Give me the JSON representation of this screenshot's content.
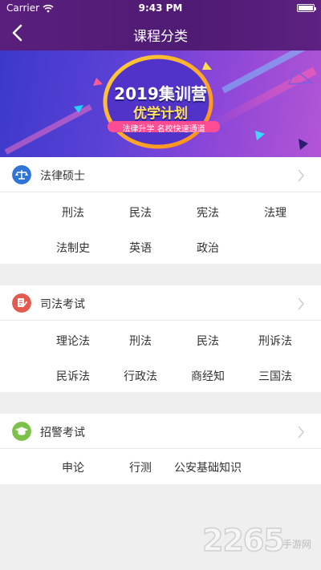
{
  "status_bar": {
    "carrier": "Carrier",
    "time": "9:43 PM"
  },
  "nav": {
    "title": "课程分类",
    "back_icon": "back-chevron-icon"
  },
  "banner": {
    "headline": "2019集训营",
    "subheadline": "优学计划",
    "tagline": "法律升学 名校快速通道"
  },
  "sections": [
    {
      "title": "法律硕士",
      "icon": "scales-icon",
      "icon_color": "#2f74d6",
      "items": [
        "刑法",
        "民法",
        "宪法",
        "法理",
        "法制史",
        "英语",
        "政治"
      ]
    },
    {
      "title": "司法考试",
      "icon": "document-pen-icon",
      "icon_color": "#e35a4e",
      "items": [
        "理论法",
        "刑法",
        "民法",
        "刑诉法",
        "民诉法",
        "行政法",
        "商经知",
        "三国法"
      ]
    },
    {
      "title": "招警考试",
      "icon": "graduation-cap-icon",
      "icon_color": "#7cc24a",
      "items": [
        "申论",
        "行测",
        "公安基础知识"
      ]
    }
  ],
  "watermark": {
    "number": "2265",
    "suffix": "手游网"
  },
  "colors": {
    "header": "#541d78",
    "background": "#efefef",
    "text": "#333333"
  }
}
